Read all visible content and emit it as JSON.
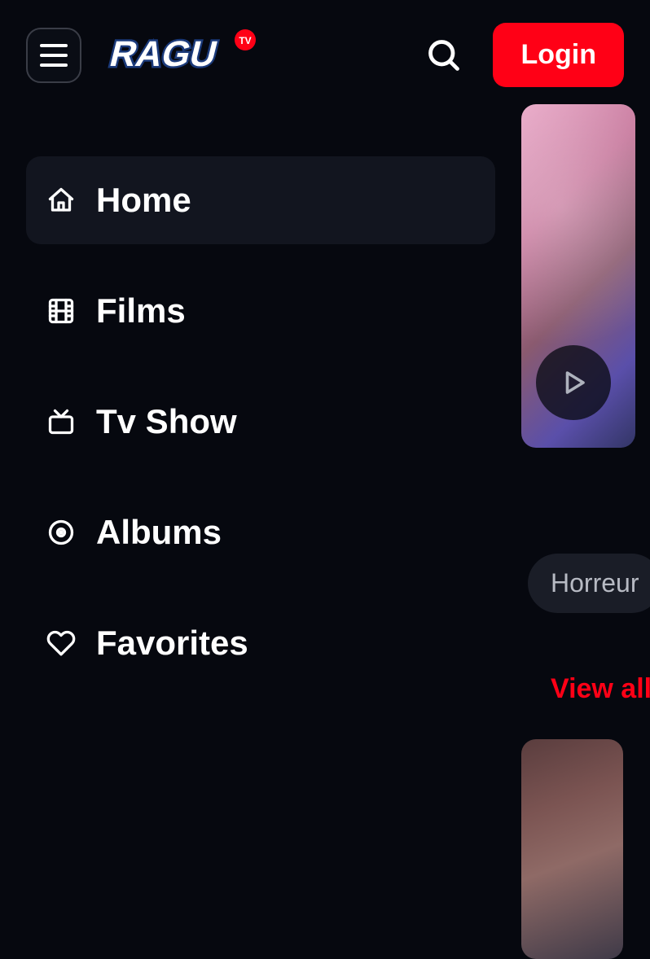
{
  "header": {
    "logo_text": "RAGU",
    "logo_badge": "TV",
    "login_label": "Login"
  },
  "sidebar": {
    "items": [
      {
        "label": "Home",
        "icon": "home-icon",
        "active": true
      },
      {
        "label": "Films",
        "icon": "film-icon",
        "active": false
      },
      {
        "label": "Tv Show",
        "icon": "tv-icon",
        "active": false
      },
      {
        "label": "Albums",
        "icon": "disc-icon",
        "active": false
      },
      {
        "label": "Favorites",
        "icon": "heart-icon",
        "active": false
      }
    ]
  },
  "content": {
    "chip_label": "Horreur",
    "view_all_label": "View all"
  },
  "colors": {
    "background": "#06080f",
    "accent": "#ff0016",
    "surface": "#12151f",
    "chip_bg": "#1a1d27",
    "chip_text": "#b7bac3"
  }
}
